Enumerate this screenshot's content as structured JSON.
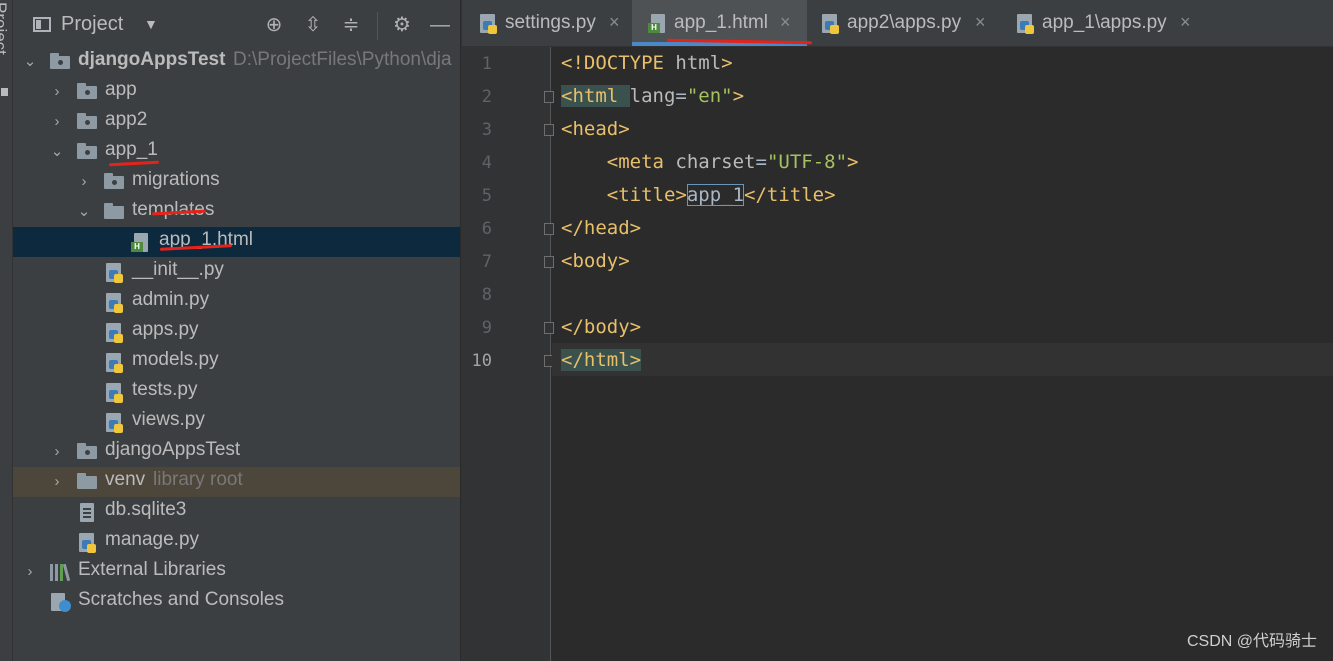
{
  "tool_strip": {
    "label": "Project"
  },
  "project_panel": {
    "title": "Project",
    "buttons": [
      "locate-icon",
      "expand-all-icon",
      "collapse-all-icon",
      "gear-icon",
      "hide-icon"
    ]
  },
  "tree": [
    {
      "label": "djangoAppsTest",
      "path": "D:\\ProjectFiles\\Python\\dja",
      "icon": "folder-icon",
      "expanded": true
    },
    {
      "label": "app",
      "icon": "folder-icon",
      "expanded": false
    },
    {
      "label": "app2",
      "icon": "folder-icon",
      "expanded": false
    },
    {
      "label": "app_1",
      "icon": "folder-icon",
      "expanded": true
    },
    {
      "label": "migrations",
      "icon": "folder-icon",
      "expanded": false
    },
    {
      "label": "templates",
      "icon": "folder-icon",
      "expanded": true
    },
    {
      "label": "app_1.html",
      "icon": "html-file-icon",
      "selected": true
    },
    {
      "label": "__init__.py",
      "icon": "python-file-icon"
    },
    {
      "label": "admin.py",
      "icon": "python-file-icon"
    },
    {
      "label": "apps.py",
      "icon": "python-file-icon"
    },
    {
      "label": "models.py",
      "icon": "python-file-icon"
    },
    {
      "label": "tests.py",
      "icon": "python-file-icon"
    },
    {
      "label": "views.py",
      "icon": "python-file-icon"
    },
    {
      "label": "djangoAppsTest",
      "icon": "folder-icon",
      "expanded": false
    },
    {
      "label": "venv",
      "note": "library root",
      "icon": "folder-icon",
      "expanded": false
    },
    {
      "label": "db.sqlite3",
      "icon": "database-file-icon"
    },
    {
      "label": "manage.py",
      "icon": "python-file-icon"
    },
    {
      "label": "External Libraries",
      "icon": "library-icon",
      "expanded": false
    },
    {
      "label": "Scratches and Consoles",
      "icon": "scratches-icon"
    }
  ],
  "tabs": [
    {
      "label": "settings.py",
      "icon": "python-file-icon",
      "active": false
    },
    {
      "label": "app_1.html",
      "icon": "html-file-icon",
      "active": true
    },
    {
      "label": "app2\\apps.py",
      "icon": "python-file-icon",
      "active": false
    },
    {
      "label": "app_1\\apps.py",
      "icon": "python-file-icon",
      "active": false
    }
  ],
  "tab_close_glyph": "×",
  "editor": {
    "current_line": 10,
    "line_numbers": [
      "1",
      "2",
      "3",
      "4",
      "5",
      "6",
      "7",
      "8",
      "9",
      "10"
    ],
    "lines": [
      {
        "indent": "",
        "tokens": [
          [
            "tag",
            "<!DOCTYPE "
          ],
          [
            "attr",
            "html"
          ],
          [
            "tag",
            ">"
          ]
        ]
      },
      {
        "indent": "",
        "tokens": [
          [
            "tag",
            "<html "
          ],
          [
            "attr",
            "lang"
          ],
          [
            "plain",
            "="
          ],
          [
            "val",
            "\"en\""
          ],
          [
            "tag",
            ">"
          ]
        ]
      },
      {
        "indent": "",
        "tokens": [
          [
            "tag",
            "<head>"
          ]
        ]
      },
      {
        "indent": "    ",
        "tokens": [
          [
            "tag",
            "<meta "
          ],
          [
            "attr",
            "charset"
          ],
          [
            "plain",
            "="
          ],
          [
            "val",
            "\"UTF-8\""
          ],
          [
            "tag",
            ">"
          ]
        ]
      },
      {
        "indent": "    ",
        "tokens": [
          [
            "tag",
            "<title>"
          ],
          [
            "plain",
            "app_1"
          ],
          [
            "tag",
            "</title>"
          ]
        ]
      },
      {
        "indent": "",
        "tokens": [
          [
            "tag",
            "</head>"
          ]
        ]
      },
      {
        "indent": "",
        "tokens": [
          [
            "tag",
            "<body>"
          ]
        ]
      },
      {
        "indent": "",
        "tokens": []
      },
      {
        "indent": "",
        "tokens": [
          [
            "tag",
            "</body>"
          ]
        ]
      },
      {
        "indent": "",
        "tokens": [
          [
            "tag",
            "</html>"
          ]
        ]
      }
    ]
  },
  "watermark": "CSDN @代码骑士"
}
